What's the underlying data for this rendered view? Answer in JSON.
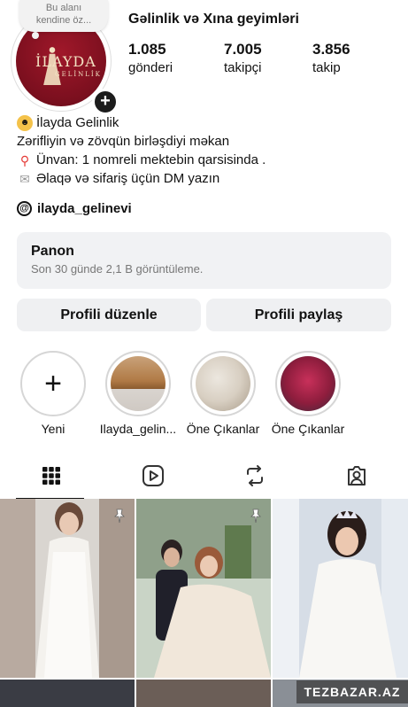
{
  "note": {
    "line1": "Bu alanı",
    "line2": "kendine öz..."
  },
  "avatar": {
    "logo_text": "İLAYDA",
    "logo_sub": "GELİNLİK"
  },
  "profile": {
    "name": "Gəlinlik və Xına geyimləri",
    "stats": [
      {
        "value": "1.085",
        "label": "gönderi"
      },
      {
        "value": "7.005",
        "label": "takipçi"
      },
      {
        "value": "3.856",
        "label": "takip"
      }
    ]
  },
  "bio": {
    "line1": "İlayda Gelinlik",
    "line2": "Zərifliyin və zövqün birləşdiyi məkan",
    "line3": "Ünvan: 1 nomreli mektebin qarsisinda .",
    "line4": "Əlaqə və sifariş üçün DM yazın"
  },
  "threads": {
    "handle": "ilayda_gelinevi"
  },
  "panel": {
    "title": "Panon",
    "subtitle": "Son 30 günde 2,1 B görüntüleme."
  },
  "buttons": {
    "edit": "Profili düzenle",
    "share": "Profili paylaş"
  },
  "highlights": [
    {
      "label": "Yeni"
    },
    {
      "label": "Ilayda_gelin..."
    },
    {
      "label": "Öne Çıkanlar"
    },
    {
      "label": "Öne Çıkanlar"
    }
  ],
  "tabs": [
    {
      "icon": "grid-icon"
    },
    {
      "icon": "reels-icon"
    },
    {
      "icon": "reposts-icon"
    },
    {
      "icon": "tagged-icon"
    }
  ],
  "watermark": "TEZBAZAR.AZ",
  "colors": {
    "brand_maroon": "#7a0f1e",
    "panel_bg": "#f1f2f4",
    "button_bg": "#eff0f2"
  }
}
